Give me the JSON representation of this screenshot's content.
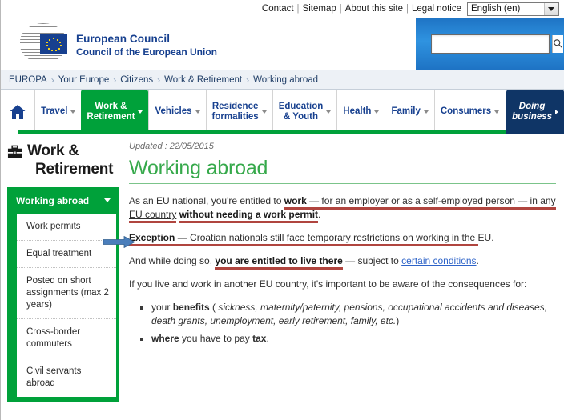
{
  "utility": {
    "links": [
      "Contact",
      "Sitemap",
      "About this site",
      "Legal notice"
    ],
    "separator": "|",
    "language": {
      "value": "English (en)",
      "icon": "chevron-down-icon"
    }
  },
  "header": {
    "logo": {
      "line1": "European Council",
      "line2": "Council of the European Union",
      "icon": "eu-council-logo"
    },
    "search": {
      "value": "",
      "placeholder": "",
      "icon": "search-icon"
    }
  },
  "breadcrumb": {
    "items": [
      "EUROPA",
      "Your Europe",
      "Citizens",
      "Work & Retirement",
      "Working abroad"
    ],
    "separator": "›"
  },
  "nav": {
    "home_icon": "home-icon",
    "items": [
      {
        "label": "Travel",
        "caret": true,
        "state": "default"
      },
      {
        "label": "Work & Retirement",
        "caret": true,
        "state": "active"
      },
      {
        "label": "Vehicles",
        "caret": true,
        "state": "default"
      },
      {
        "label": "Residence formalities",
        "caret": true,
        "state": "default"
      },
      {
        "label": "Education & Youth",
        "caret": true,
        "state": "default"
      },
      {
        "label": "Health",
        "caret": true,
        "state": "default"
      },
      {
        "label": "Family",
        "caret": true,
        "state": "default"
      },
      {
        "label": "Consumers",
        "caret": true,
        "state": "default"
      },
      {
        "label": "Doing business",
        "caret": true,
        "state": "business"
      }
    ]
  },
  "sidebar": {
    "icon": "briefcase-icon",
    "title_line1": "Work &",
    "title_line2": "Retirement",
    "menu_header": {
      "label": "Working abroad",
      "icon": "chevron-down-icon"
    },
    "items": [
      "Work permits",
      "Equal treatment",
      "Posted on short assignments (max 2 years)",
      "Cross-border commuters",
      "Civil servants abroad"
    ]
  },
  "main": {
    "updated": "Updated : 22/05/2015",
    "title": "Working abroad",
    "p1": {
      "t1": "As an EU national, you're entitled to ",
      "b1": "work",
      "t2": " — for an employer or as a self-employed person — in any ",
      "link": "EU country",
      "t3": " ",
      "b2": "without needing a work permit",
      "t4": "."
    },
    "p2": {
      "b1": "Exception",
      "t1": " — Croatian nationals still face temporary restrictions on working in the ",
      "link": "EU",
      "t2": "."
    },
    "p3": {
      "t1": "And while doing so, ",
      "b1": "you are entitled to live there",
      "t2": " — subject to ",
      "link": "certain conditions",
      "t3": "."
    },
    "p4": "If you live and work in another EU country, it's important to be aware of the consequences for:",
    "bullets": [
      {
        "t1": "your ",
        "b1": "benefits",
        "t2": " ( ",
        "italic": "sickness, maternity/paternity, pensions, occupational accidents and diseases, death grants, unemployment, early retirement, family, etc.",
        "t3": ")"
      },
      {
        "b1": "where",
        "t2": " you have to pay ",
        "b2": "tax",
        "t3": "."
      }
    ],
    "annotation_arrow": "blue-arrow-pointing-right"
  },
  "colors": {
    "green": "#00a13a",
    "title_green": "#36a94b",
    "navy": "#0f3566",
    "link_blue": "#2d63c8",
    "underline_red": "#b0453f",
    "search_blue": "#2f93e0"
  }
}
